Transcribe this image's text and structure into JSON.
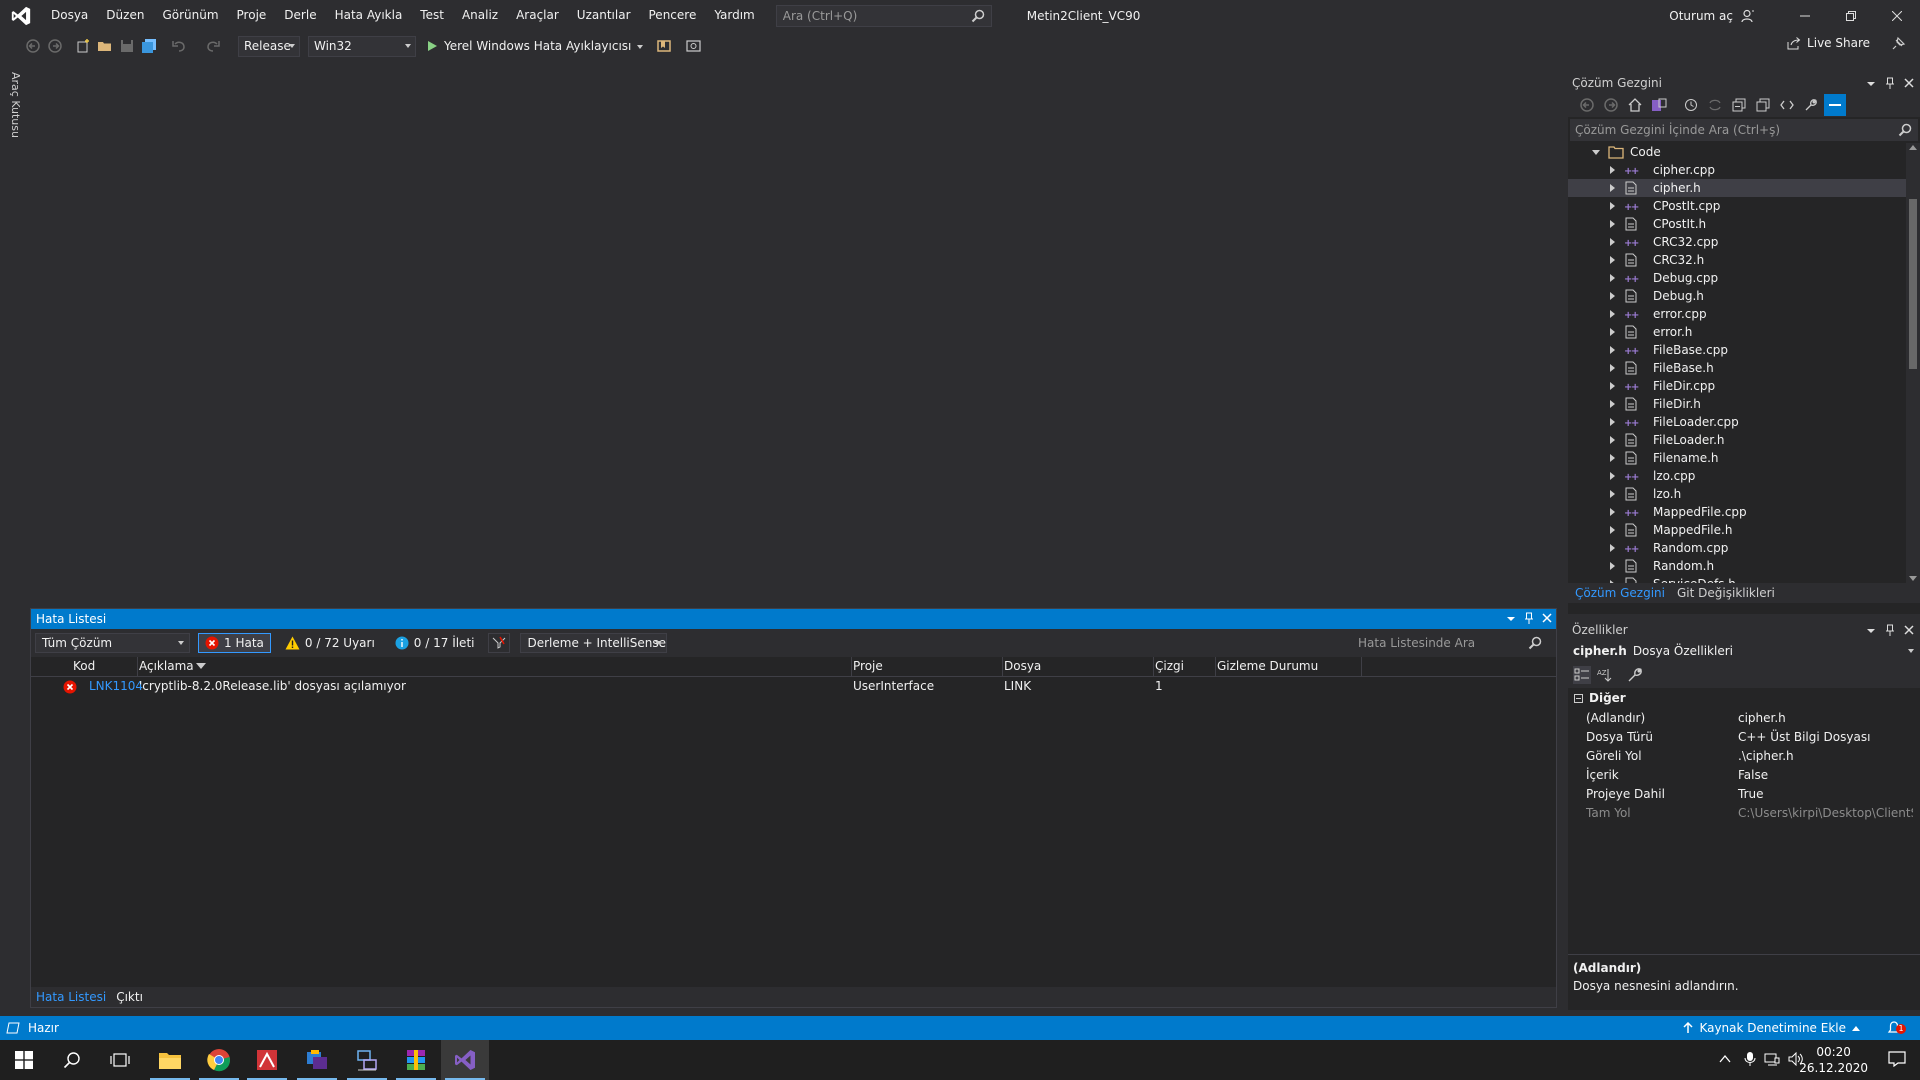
{
  "menu": {
    "items": [
      "Dosya",
      "Düzen",
      "Görünüm",
      "Proje",
      "Derle",
      "Hata Ayıkla",
      "Test",
      "Analiz",
      "Araçlar",
      "Uzantılar",
      "Pencere",
      "Yardım"
    ],
    "search_placeholder": "Ara (Ctrl+Q)",
    "solution_name": "Metin2Client_VC90",
    "signin": "Oturum aç"
  },
  "toolbar": {
    "config": "Release",
    "platform": "Win32",
    "run_label": "Yerel Windows Hata Ayıklayıcısı",
    "live_share": "Live Share"
  },
  "toolbox_label": "Araç Kutusu",
  "error_list": {
    "title": "Hata Listesi",
    "scope": "Tüm Çözüm",
    "errors": "1 Hata",
    "warnings": "0 / 72 Uyarı",
    "messages": "0 / 17 İleti",
    "build_filter": "Derleme + IntelliSense",
    "search_placeholder": "Hata Listesinde Ara",
    "columns": {
      "code": "Kod",
      "description": "Açıklama",
      "project": "Proje",
      "file": "Dosya",
      "line": "Çizgi",
      "suppression": "Gizleme Durumu"
    },
    "rows": [
      {
        "code": "LNK1104",
        "description": "'cryptlib-8.2.0Release.lib' dosyası açılamıyor",
        "project": "UserInterface",
        "file": "LINK",
        "line": "1"
      }
    ],
    "tabs": [
      "Hata Listesi",
      "Çıktı"
    ]
  },
  "solution_explorer": {
    "title": "Çözüm Gezgini",
    "search_placeholder": "Çözüm Gezgini İçinde Ara (Ctrl+ş)",
    "folder": "Code",
    "items": [
      {
        "name": "cipher.cpp",
        "type": "cpp"
      },
      {
        "name": "cipher.h",
        "type": "h"
      },
      {
        "name": "CPostIt.cpp",
        "type": "cpp"
      },
      {
        "name": "CPostIt.h",
        "type": "h"
      },
      {
        "name": "CRC32.cpp",
        "type": "cpp"
      },
      {
        "name": "CRC32.h",
        "type": "h"
      },
      {
        "name": "Debug.cpp",
        "type": "cpp"
      },
      {
        "name": "Debug.h",
        "type": "h"
      },
      {
        "name": "error.cpp",
        "type": "cpp"
      },
      {
        "name": "error.h",
        "type": "h"
      },
      {
        "name": "FileBase.cpp",
        "type": "cpp"
      },
      {
        "name": "FileBase.h",
        "type": "h"
      },
      {
        "name": "FileDir.cpp",
        "type": "cpp"
      },
      {
        "name": "FileDir.h",
        "type": "h"
      },
      {
        "name": "FileLoader.cpp",
        "type": "cpp"
      },
      {
        "name": "FileLoader.h",
        "type": "h"
      },
      {
        "name": "Filename.h",
        "type": "h"
      },
      {
        "name": "lzo.cpp",
        "type": "cpp"
      },
      {
        "name": "lzo.h",
        "type": "h"
      },
      {
        "name": "MappedFile.cpp",
        "type": "cpp"
      },
      {
        "name": "MappedFile.h",
        "type": "h"
      },
      {
        "name": "Random.cpp",
        "type": "cpp"
      },
      {
        "name": "Random.h",
        "type": "h"
      },
      {
        "name": "ServiceDefs.h",
        "type": "h"
      }
    ],
    "selected": "cipher.h",
    "tabs": [
      "Çözüm Gezgini",
      "Git Değişiklikleri"
    ]
  },
  "properties": {
    "title": "Özellikler",
    "object_name": "cipher.h",
    "object_type": "Dosya Özellikleri",
    "category": "Diğer",
    "rows": [
      {
        "name": "(Adlandır)",
        "value": "cipher.h"
      },
      {
        "name": "Dosya Türü",
        "value": "C++ Üst Bilgi Dosyası"
      },
      {
        "name": "Göreli Yol",
        "value": ".\\cipher.h"
      },
      {
        "name": "İçerik",
        "value": "False"
      },
      {
        "name": "Projeye Dahil",
        "value": "True"
      },
      {
        "name": "Tam Yol",
        "value": "C:\\Users\\kirpi\\Desktop\\ClientSou"
      }
    ],
    "desc_title": "(Adlandır)",
    "desc_text": "Dosya nesnesini adlandırın."
  },
  "status": {
    "ready": "Hazır",
    "source_control": "Kaynak Denetimine Ekle",
    "notifications": "1"
  },
  "taskbar": {
    "time": "00:20",
    "date": "26.12.2020"
  },
  "colors": {
    "accent": "#007acc",
    "error": "#e51400",
    "warning": "#ffcc00",
    "info": "#1ba1e2",
    "cpp_icon": "#9b7bd3",
    "vs_purple": "#865fc5"
  }
}
